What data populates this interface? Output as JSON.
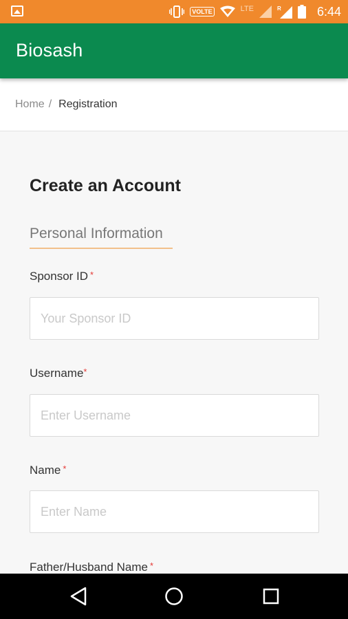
{
  "status_bar": {
    "volte": "VOLTE",
    "lte": "LTE",
    "roaming": "R",
    "time": "6:44",
    "color": "#f0892c"
  },
  "app_bar": {
    "title": "Biosash",
    "color": "#0b8a4f"
  },
  "breadcrumb": {
    "home": "Home",
    "separator": "/",
    "current": "Registration"
  },
  "form": {
    "title": "Create an Account",
    "section_tab": "Personal Information",
    "required_marker": "*",
    "fields": [
      {
        "label": "Sponsor ID",
        "placeholder": "Your Sponsor ID",
        "value": ""
      },
      {
        "label": "Username",
        "placeholder": "Enter Username",
        "value": ""
      },
      {
        "label": "Name",
        "placeholder": "Enter Name",
        "value": ""
      },
      {
        "label": "Father/Husband Name",
        "placeholder": "",
        "value": ""
      }
    ]
  },
  "nav_bar": {
    "icons": [
      "back-icon",
      "home-icon",
      "recents-icon"
    ]
  }
}
